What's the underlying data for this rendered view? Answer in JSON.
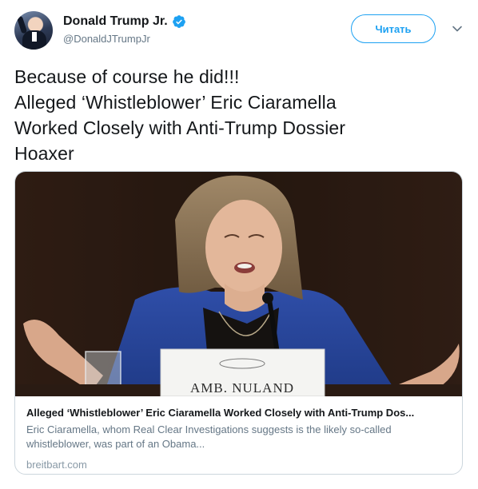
{
  "author": {
    "display_name": "Donald Trump Jr.",
    "handle": "@DonaldJTrumpJr",
    "verified": true
  },
  "actions": {
    "follow_label": "Читать"
  },
  "icons": {
    "verified": "verified-badge-icon",
    "menu": "chevron-down-icon"
  },
  "tweet": {
    "lines": [
      "Because of course he did!!!",
      "Alleged ‘Whistleblower’ Eric Ciaramella",
      "Worked Closely with Anti-Trump Dossier",
      "Hoaxer"
    ]
  },
  "card": {
    "image_placard": "AMB. NULAND",
    "title": "Alleged ‘Whistleblower’ Eric Ciaramella Worked Closely with Anti-Trump Dos...",
    "description_lines": [
      "Eric Ciaramella, whom Real Clear Investigations suggests is the likely so-called",
      "whistleblower, was part of an Obama..."
    ],
    "domain": "breitbart.com"
  },
  "colors": {
    "accent": "#1da1f2",
    "text": "#14171a",
    "secondary": "#657786",
    "border": "#ccd6dd"
  }
}
